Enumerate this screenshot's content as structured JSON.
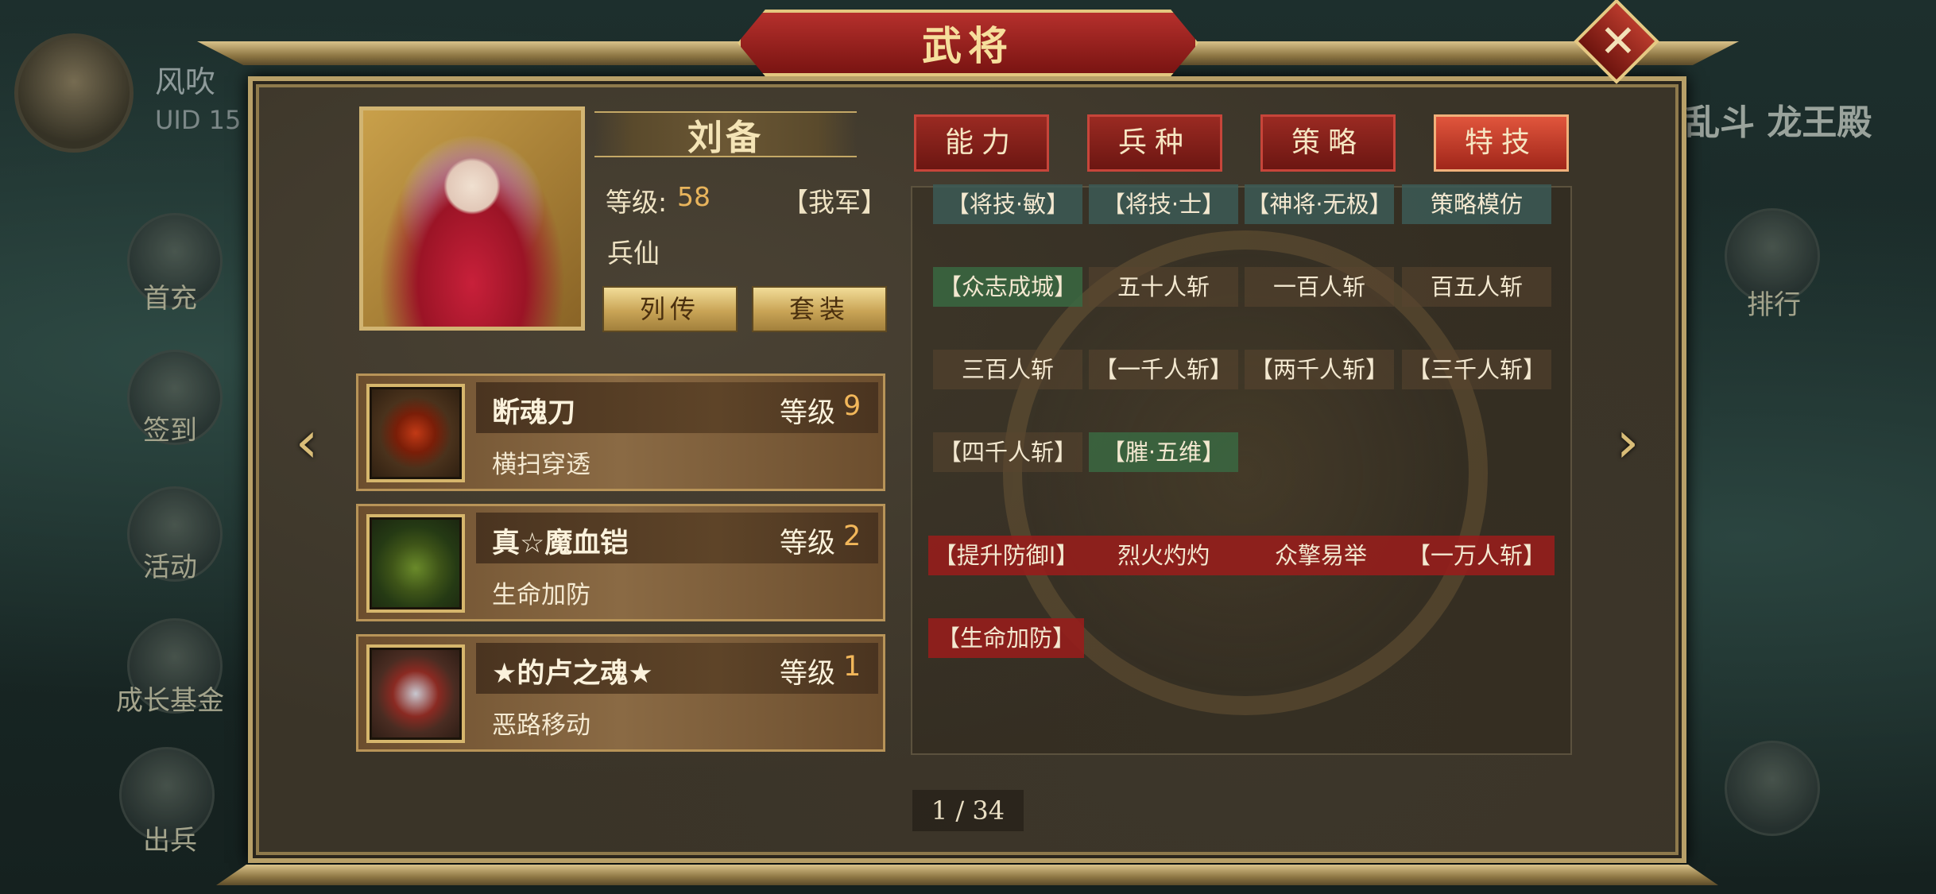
{
  "background": {
    "player_name": "风吹",
    "uid_label": "UID 15",
    "side_menu": [
      "首充",
      "签到",
      "活动",
      "成长基金",
      "出兵"
    ],
    "right_menu": [
      "排行"
    ],
    "right_title": "乱斗 龙王殿"
  },
  "dialog": {
    "title": "武将",
    "close_label": "✕"
  },
  "hero": {
    "name": "刘备",
    "level_label": "等级:",
    "level": "58",
    "faction": "【我军】",
    "type": "兵仙",
    "buttons": {
      "biography": "列传",
      "set": "套装"
    }
  },
  "equipment": [
    {
      "name": "断魂刀",
      "level_label": "等级",
      "level": "9",
      "skill": "横扫穿透",
      "icon": "sword-icon"
    },
    {
      "name": "真☆魔血铠",
      "level_label": "等级",
      "level": "2",
      "skill": "生命加防",
      "icon": "armor-icon"
    },
    {
      "name": "★的卢之魂★",
      "level_label": "等级",
      "level": "1",
      "skill": "恶路移动",
      "icon": "horse-icon"
    }
  ],
  "nav": {
    "prev": "‹",
    "next": "›"
  },
  "tabs": [
    {
      "label": "能力",
      "active": false
    },
    {
      "label": "兵种",
      "active": false
    },
    {
      "label": "策略",
      "active": false
    },
    {
      "label": "特技",
      "active": true
    }
  ],
  "skills": [
    [
      "【将技·敏】",
      "【将技·士】",
      "【神将·无极】",
      "策略模仿"
    ],
    [
      "【众志成城】",
      "五十人斩",
      "一百人斩",
      "百五人斩"
    ],
    [
      "三百人斩",
      "【一千人斩】",
      "【两千人斩】",
      "【三千人斩】"
    ],
    [
      "【四千人斩】",
      "【膗·五维】"
    ],
    [
      "【提升防御Ⅰ】",
      "烈火灼灼",
      "众擎易举",
      "【一万人斩】"
    ],
    [
      "【生命加防】"
    ]
  ],
  "pager": {
    "text": "1 / 34"
  },
  "colors": {
    "accent_gold": "#d1b472",
    "tab_red": "#9a2a22",
    "tab_active": "#e0553c",
    "level_orange": "#e8b45c"
  }
}
